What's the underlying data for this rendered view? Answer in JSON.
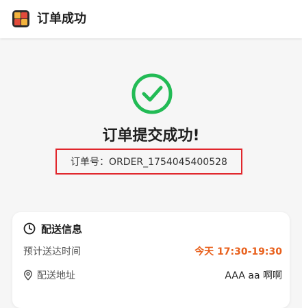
{
  "header": {
    "title": "订单成功",
    "logo_icon": "app-logo-icon"
  },
  "success": {
    "icon": "check-circle-icon",
    "icon_color": "#22bb55",
    "title": "订单提交成功!",
    "order_number_text": "订单号：ORDER_1754045400528",
    "highlight_color": "#e1262c"
  },
  "delivery": {
    "title": "配送信息",
    "title_icon": "clock-icon",
    "time_label": "预计送达时间",
    "time_value": "今天 17:30-19:30",
    "time_color": "#e8601c",
    "address_icon": "location-pin-icon",
    "address_label": "配送地址",
    "address_value": "AAA aa 啊啊"
  }
}
